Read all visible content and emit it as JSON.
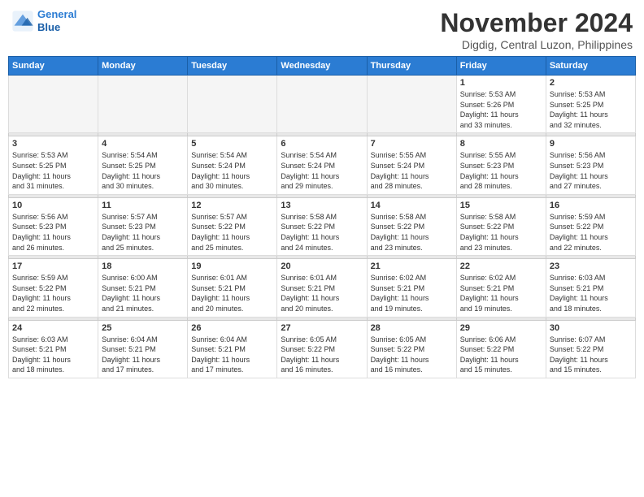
{
  "header": {
    "logo_line1": "General",
    "logo_line2": "Blue",
    "month": "November 2024",
    "location": "Digdig, Central Luzon, Philippines"
  },
  "weekdays": [
    "Sunday",
    "Monday",
    "Tuesday",
    "Wednesday",
    "Thursday",
    "Friday",
    "Saturday"
  ],
  "weeks": [
    [
      {
        "day": "",
        "info": ""
      },
      {
        "day": "",
        "info": ""
      },
      {
        "day": "",
        "info": ""
      },
      {
        "day": "",
        "info": ""
      },
      {
        "day": "",
        "info": ""
      },
      {
        "day": "1",
        "info": "Sunrise: 5:53 AM\nSunset: 5:26 PM\nDaylight: 11 hours\nand 33 minutes."
      },
      {
        "day": "2",
        "info": "Sunrise: 5:53 AM\nSunset: 5:25 PM\nDaylight: 11 hours\nand 32 minutes."
      }
    ],
    [
      {
        "day": "3",
        "info": "Sunrise: 5:53 AM\nSunset: 5:25 PM\nDaylight: 11 hours\nand 31 minutes."
      },
      {
        "day": "4",
        "info": "Sunrise: 5:54 AM\nSunset: 5:25 PM\nDaylight: 11 hours\nand 30 minutes."
      },
      {
        "day": "5",
        "info": "Sunrise: 5:54 AM\nSunset: 5:24 PM\nDaylight: 11 hours\nand 30 minutes."
      },
      {
        "day": "6",
        "info": "Sunrise: 5:54 AM\nSunset: 5:24 PM\nDaylight: 11 hours\nand 29 minutes."
      },
      {
        "day": "7",
        "info": "Sunrise: 5:55 AM\nSunset: 5:24 PM\nDaylight: 11 hours\nand 28 minutes."
      },
      {
        "day": "8",
        "info": "Sunrise: 5:55 AM\nSunset: 5:23 PM\nDaylight: 11 hours\nand 28 minutes."
      },
      {
        "day": "9",
        "info": "Sunrise: 5:56 AM\nSunset: 5:23 PM\nDaylight: 11 hours\nand 27 minutes."
      }
    ],
    [
      {
        "day": "10",
        "info": "Sunrise: 5:56 AM\nSunset: 5:23 PM\nDaylight: 11 hours\nand 26 minutes."
      },
      {
        "day": "11",
        "info": "Sunrise: 5:57 AM\nSunset: 5:23 PM\nDaylight: 11 hours\nand 25 minutes."
      },
      {
        "day": "12",
        "info": "Sunrise: 5:57 AM\nSunset: 5:22 PM\nDaylight: 11 hours\nand 25 minutes."
      },
      {
        "day": "13",
        "info": "Sunrise: 5:58 AM\nSunset: 5:22 PM\nDaylight: 11 hours\nand 24 minutes."
      },
      {
        "day": "14",
        "info": "Sunrise: 5:58 AM\nSunset: 5:22 PM\nDaylight: 11 hours\nand 23 minutes."
      },
      {
        "day": "15",
        "info": "Sunrise: 5:58 AM\nSunset: 5:22 PM\nDaylight: 11 hours\nand 23 minutes."
      },
      {
        "day": "16",
        "info": "Sunrise: 5:59 AM\nSunset: 5:22 PM\nDaylight: 11 hours\nand 22 minutes."
      }
    ],
    [
      {
        "day": "17",
        "info": "Sunrise: 5:59 AM\nSunset: 5:22 PM\nDaylight: 11 hours\nand 22 minutes."
      },
      {
        "day": "18",
        "info": "Sunrise: 6:00 AM\nSunset: 5:21 PM\nDaylight: 11 hours\nand 21 minutes."
      },
      {
        "day": "19",
        "info": "Sunrise: 6:01 AM\nSunset: 5:21 PM\nDaylight: 11 hours\nand 20 minutes."
      },
      {
        "day": "20",
        "info": "Sunrise: 6:01 AM\nSunset: 5:21 PM\nDaylight: 11 hours\nand 20 minutes."
      },
      {
        "day": "21",
        "info": "Sunrise: 6:02 AM\nSunset: 5:21 PM\nDaylight: 11 hours\nand 19 minutes."
      },
      {
        "day": "22",
        "info": "Sunrise: 6:02 AM\nSunset: 5:21 PM\nDaylight: 11 hours\nand 19 minutes."
      },
      {
        "day": "23",
        "info": "Sunrise: 6:03 AM\nSunset: 5:21 PM\nDaylight: 11 hours\nand 18 minutes."
      }
    ],
    [
      {
        "day": "24",
        "info": "Sunrise: 6:03 AM\nSunset: 5:21 PM\nDaylight: 11 hours\nand 18 minutes."
      },
      {
        "day": "25",
        "info": "Sunrise: 6:04 AM\nSunset: 5:21 PM\nDaylight: 11 hours\nand 17 minutes."
      },
      {
        "day": "26",
        "info": "Sunrise: 6:04 AM\nSunset: 5:21 PM\nDaylight: 11 hours\nand 17 minutes."
      },
      {
        "day": "27",
        "info": "Sunrise: 6:05 AM\nSunset: 5:22 PM\nDaylight: 11 hours\nand 16 minutes."
      },
      {
        "day": "28",
        "info": "Sunrise: 6:05 AM\nSunset: 5:22 PM\nDaylight: 11 hours\nand 16 minutes."
      },
      {
        "day": "29",
        "info": "Sunrise: 6:06 AM\nSunset: 5:22 PM\nDaylight: 11 hours\nand 15 minutes."
      },
      {
        "day": "30",
        "info": "Sunrise: 6:07 AM\nSunset: 5:22 PM\nDaylight: 11 hours\nand 15 minutes."
      }
    ]
  ]
}
